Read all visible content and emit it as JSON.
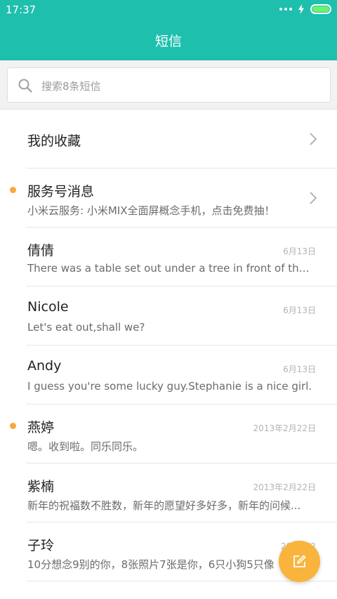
{
  "status_bar": {
    "time": "17:37"
  },
  "header": {
    "title": "短信"
  },
  "search": {
    "placeholder": "搜索8条短信"
  },
  "favorites": {
    "label": "我的收藏"
  },
  "conversations": [
    {
      "name": "服务号消息",
      "preview": "小米云服务: 小米MIX全面屏概念手机，点击免费抽！",
      "date": "",
      "unread": true
    },
    {
      "name": "倩倩",
      "preview": "There was a table set out under a tree in front of the h...",
      "date": "6月13日",
      "unread": false
    },
    {
      "name": "Nicole",
      "preview": "Let's eat out,shall we?",
      "date": "6月13日",
      "unread": false
    },
    {
      "name": "Andy",
      "preview": "I guess you're some lucky guy.Stephanie is a nice girl.",
      "date": "6月13日",
      "unread": false
    },
    {
      "name": "燕婷",
      "preview": "嗯。收到啦。同乐同乐。",
      "date": "2013年2月22日",
      "unread": true
    },
    {
      "name": "紫楠",
      "preview": "新年的祝福数不胜数，新年的愿望好多好多，新年的问候...",
      "date": "2013年2月22日",
      "unread": false
    },
    {
      "name": "子玲",
      "preview": "10分想念9别的你，8张照片7张是你，6只小狗5只像",
      "date": "2013年2",
      "unread": false
    }
  ],
  "colors": {
    "header": "#1fbfae",
    "accent": "#f8b43c",
    "unread_dot": "#f7a93a"
  },
  "icons": {
    "search": "search-icon",
    "compose": "compose-icon",
    "chevron": "chevron-right-icon"
  }
}
